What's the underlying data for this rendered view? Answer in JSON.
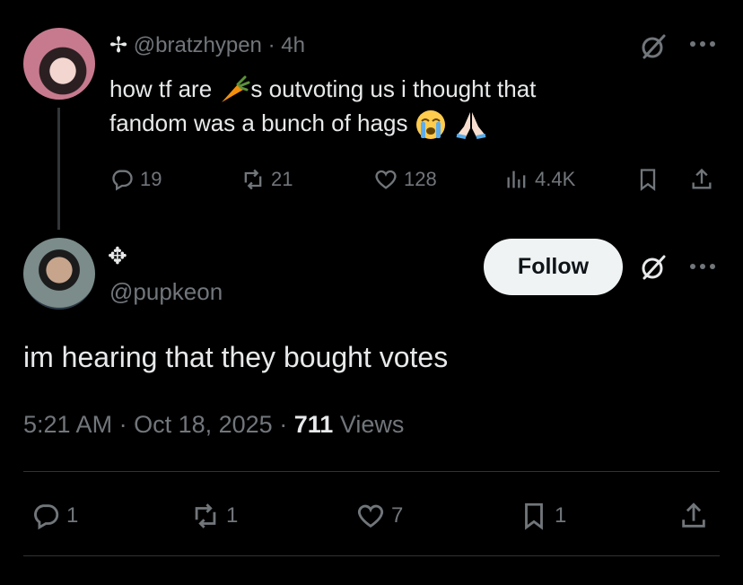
{
  "parent_tweet": {
    "name_symbol": "✢",
    "handle": "@bratzhypen",
    "separator": "·",
    "time": "4h",
    "text_part1": "how tf are",
    "text_part2": "s outvoting us i thought that",
    "text_part3": "fandom was a bunch of hags",
    "emoji_carrot": "🥕",
    "emoji_cry": "😭",
    "emoji_pray": "🙏🏻",
    "replies": "19",
    "reposts": "21",
    "likes": "128",
    "views": "4.4K",
    "icons": [
      "grok-icon",
      "more-icon",
      "reply-icon",
      "repost-icon",
      "like-icon",
      "views-icon",
      "bookmark-icon",
      "share-icon"
    ]
  },
  "main_tweet": {
    "name_symbol": "✥",
    "handle": "@pupkeon",
    "follow_label": "Follow",
    "text": "im hearing that they bought votes",
    "time": "5:21 AM",
    "sep1": "·",
    "date": "Oct 18, 2025",
    "sep2": "·",
    "views_count": "711",
    "views_label": "Views",
    "replies": "1",
    "reposts": "1",
    "likes": "7",
    "bookmarks": "1"
  },
  "colors": {
    "background": "#000000",
    "text": "#e7e9ea",
    "muted": "#71767b",
    "follow_bg": "#eff3f4",
    "divider": "#2f3336"
  }
}
